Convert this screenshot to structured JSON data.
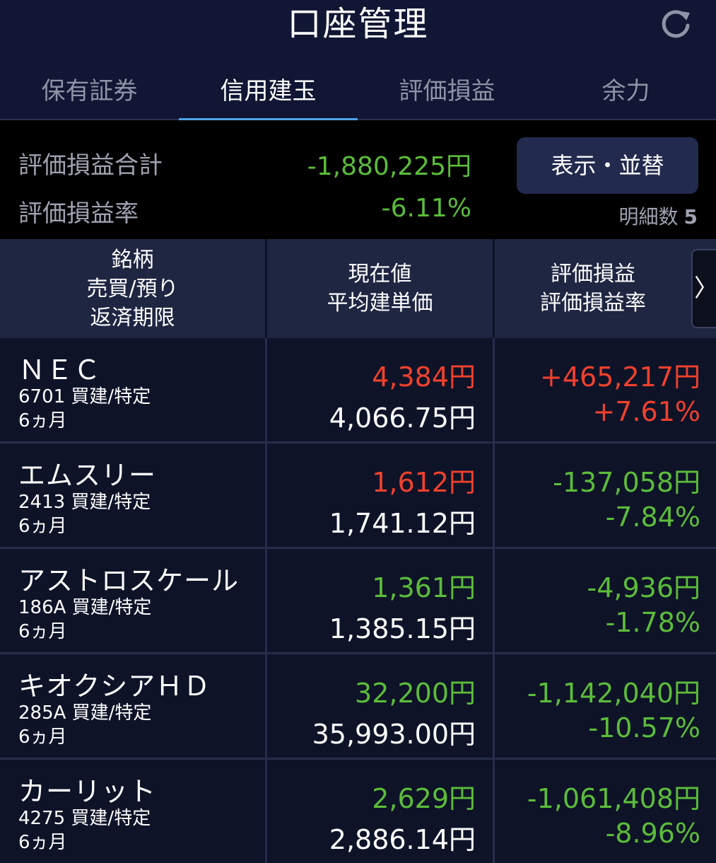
{
  "header": {
    "title": "口座管理"
  },
  "tabs": [
    {
      "label": "保有証券",
      "active": false
    },
    {
      "label": "信用建玉",
      "active": true
    },
    {
      "label": "評価損益",
      "active": false
    },
    {
      "label": "余力",
      "active": false
    }
  ],
  "summary": {
    "total_label": "評価損益合計",
    "total_value": "-1,880,225円",
    "rate_label": "評価損益率",
    "rate_value": "-6.11%",
    "sort_button": "表示・並替",
    "count_label": "明細数",
    "count_value": "5"
  },
  "table_header": {
    "col1": [
      "銘柄",
      "売買/預り",
      "返済期限"
    ],
    "col2": [
      "現在値",
      "平均建単価"
    ],
    "col3": [
      "評価損益",
      "評価損益率"
    ],
    "next": "〉"
  },
  "colors": {
    "gain": "#f0412d",
    "loss": "#5cbc3a",
    "accent": "#4fa3e9"
  },
  "rows": [
    {
      "name": "ＮＥＣ",
      "code_type": "6701 買建/特定",
      "term": "6ヵ月",
      "price": "4,384円",
      "price_color": "red",
      "avg_price": "4,066.75円",
      "pl": "+465,217円",
      "pl_rate": "+7.61%",
      "pl_color": "red"
    },
    {
      "name": "エムスリー",
      "code_type": "2413 買建/特定",
      "term": "6ヵ月",
      "price": "1,612円",
      "price_color": "red",
      "avg_price": "1,741.12円",
      "pl": "-137,058円",
      "pl_rate": "-7.84%",
      "pl_color": "green"
    },
    {
      "name": "アストロスケール",
      "code_type": "186A 買建/特定",
      "term": "6ヵ月",
      "price": "1,361円",
      "price_color": "green",
      "avg_price": "1,385.15円",
      "pl": "-4,936円",
      "pl_rate": "-1.78%",
      "pl_color": "green"
    },
    {
      "name": "キオクシアＨＤ",
      "code_type": "285A 買建/特定",
      "term": "6ヵ月",
      "price": "32,200円",
      "price_color": "green",
      "avg_price": "35,993.00円",
      "pl": "-1,142,040円",
      "pl_rate": "-10.57%",
      "pl_color": "green"
    },
    {
      "name": "カーリット",
      "code_type": "4275 買建/特定",
      "term": "6ヵ月",
      "price": "2,629円",
      "price_color": "green",
      "avg_price": "2,886.14円",
      "pl": "-1,061,408円",
      "pl_rate": "-8.96%",
      "pl_color": "green"
    }
  ]
}
